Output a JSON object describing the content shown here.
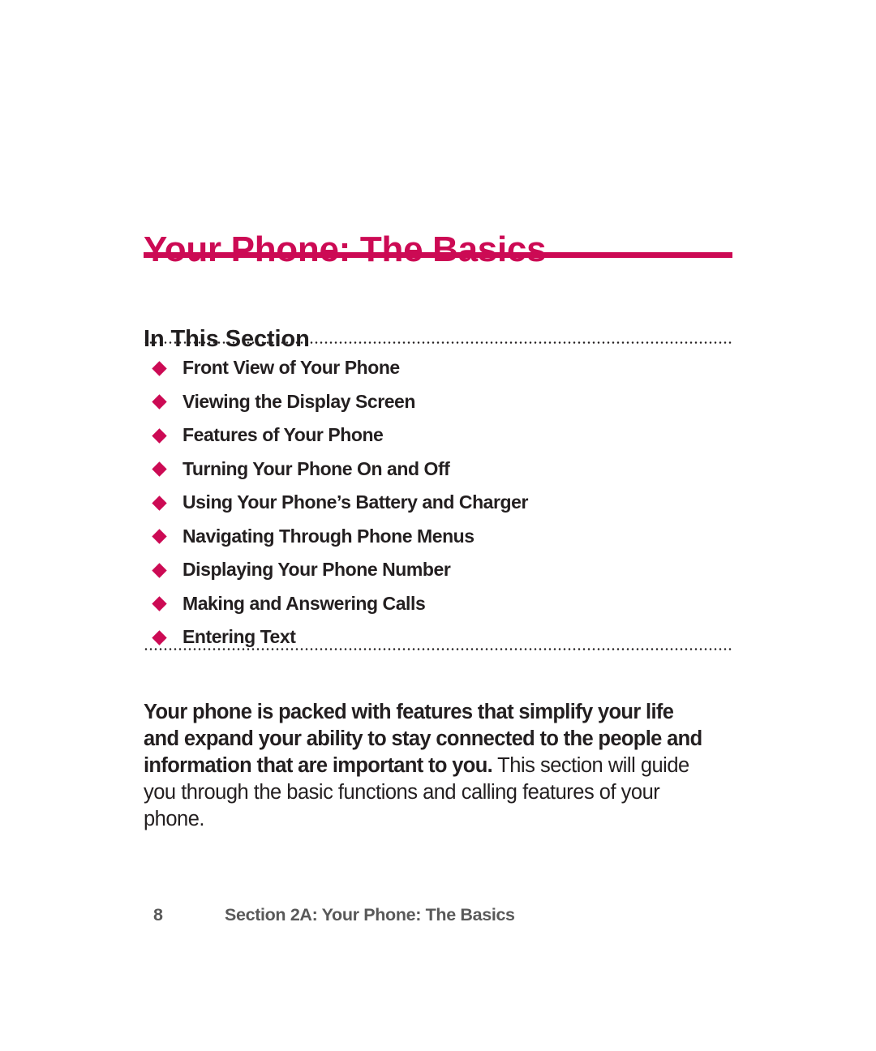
{
  "page": {
    "background_color": "#FFFFFF",
    "accent_color": "#CC0A54",
    "text_color": "#231F20",
    "footer_color": "#595959"
  },
  "chapter": {
    "title": "Your Phone: The Basics"
  },
  "section": {
    "heading": "In This Section",
    "items": [
      {
        "label": "Front View of Your Phone"
      },
      {
        "label": "Viewing the Display Screen"
      },
      {
        "label": "Features of Your Phone"
      },
      {
        "label": "Turning Your  Phone On and Off"
      },
      {
        "label": "Using Your Phone’s Battery and Charger"
      },
      {
        "label": "Navigating Through Phone Menus"
      },
      {
        "label": "Displaying Your Phone Number"
      },
      {
        "label": "Making and Answering Calls"
      },
      {
        "label": "Entering Text"
      }
    ]
  },
  "intro": {
    "lead": "Your phone is packed with features that simplify your life and expand your ability to stay connected to the people and information that are important to you.",
    "rest": " This section will guide you through the basic functions and calling features of your phone."
  },
  "footer": {
    "page_number": "8",
    "caption": "Section 2A: Your Phone: The Basics"
  }
}
